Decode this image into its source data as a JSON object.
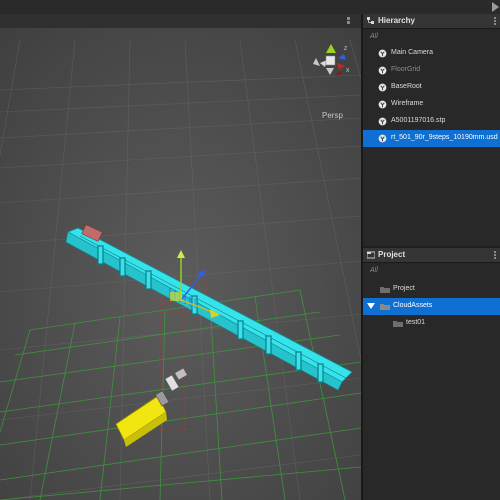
{
  "viewport": {
    "camera_mode": "Persp",
    "gizmo_axes": {
      "y": "Y",
      "z": "Z",
      "x": "X"
    }
  },
  "hierarchy": {
    "title": "Hierarchy",
    "filter_placeholder": "All",
    "items": [
      {
        "label": "Main Camera",
        "state": "normal"
      },
      {
        "label": "FloorGrid",
        "state": "dimmed"
      },
      {
        "label": "BaseRoot",
        "state": "normal"
      },
      {
        "label": "Wireframe",
        "state": "normal"
      },
      {
        "label": "A5001197016.stp",
        "state": "normal"
      },
      {
        "label": "rt_501_90r_9steps_10190mm.usd",
        "state": "selected"
      }
    ]
  },
  "project": {
    "title": "Project",
    "filter_placeholder": "All",
    "items": [
      {
        "label": "Project",
        "level": 0,
        "selected": false
      },
      {
        "label": "CloudAssets",
        "level": 0,
        "selected": true,
        "expanded": true
      },
      {
        "label": "test01",
        "level": 1,
        "selected": false
      }
    ]
  },
  "colors": {
    "selection": "#0f6fd2",
    "conveyor": "#37e3eb",
    "motor": "#f2e611",
    "grid": "#3d9a3d"
  },
  "icons": {
    "hierarchy_icon": "hierarchy-icon",
    "project_icon": "project-icon",
    "object_icon": "gear-icon",
    "folder_icon": "folder-icon",
    "play_icon": "play-icon"
  }
}
